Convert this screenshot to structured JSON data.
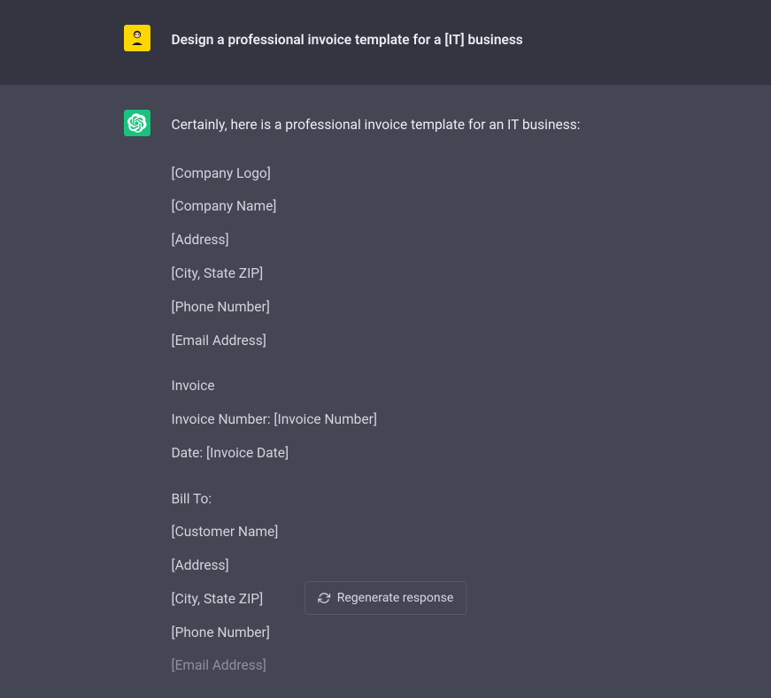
{
  "user": {
    "prompt": "Design a professional invoice template for a [IT] business"
  },
  "assistant": {
    "intro": "Certainly, here is a professional invoice template for an IT business:",
    "block1": {
      "line0": "[Company Logo]",
      "line1": "[Company Name]",
      "line2": "[Address]",
      "line3": "[City, State ZIP]",
      "line4": "[Phone Number]",
      "line5": "[Email Address]"
    },
    "block2": {
      "line0": "Invoice",
      "line1": "Invoice Number: [Invoice Number]",
      "line2": "Date: [Invoice Date]"
    },
    "block3": {
      "line0": "Bill To:",
      "line1": "[Customer Name]",
      "line2": "[Address]",
      "line3": "[City, State ZIP]",
      "line4": "[Phone Number]",
      "line5": "[Email Address]"
    }
  },
  "controls": {
    "regenerate_label": "Regenerate response"
  }
}
